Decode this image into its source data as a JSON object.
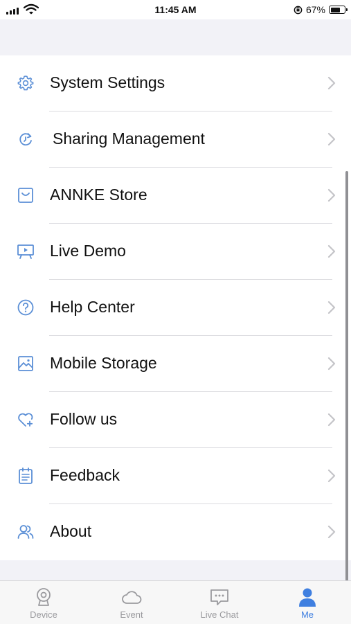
{
  "status_bar": {
    "time": "11:45 AM",
    "battery_percent": "67%",
    "battery_level": 0.67
  },
  "colors": {
    "accent": "#3f7fe0",
    "icon_blue": "#5b8fd6",
    "inactive_tab": "#9a9a9e",
    "chevron": "#c4c4c8"
  },
  "menu": {
    "items": [
      {
        "label": "System Settings",
        "icon": "gear-icon"
      },
      {
        "label": "Sharing Management",
        "icon": "share-refresh-icon"
      },
      {
        "label": "ANNKE Store",
        "icon": "store-icon"
      },
      {
        "label": "Live Demo",
        "icon": "presentation-icon"
      },
      {
        "label": "Help Center",
        "icon": "question-circle-icon"
      },
      {
        "label": "Mobile Storage",
        "icon": "image-icon"
      },
      {
        "label": "Follow us",
        "icon": "heart-plus-icon"
      },
      {
        "label": "Feedback",
        "icon": "clipboard-list-icon"
      },
      {
        "label": "About",
        "icon": "people-icon"
      }
    ]
  },
  "tabbar": {
    "tabs": [
      {
        "label": "Device",
        "icon": "camera-icon",
        "active": false
      },
      {
        "label": "Event",
        "icon": "cloud-icon",
        "active": false
      },
      {
        "label": "Live Chat",
        "icon": "chat-icon",
        "active": false
      },
      {
        "label": "Me",
        "icon": "person-icon",
        "active": true
      }
    ]
  }
}
